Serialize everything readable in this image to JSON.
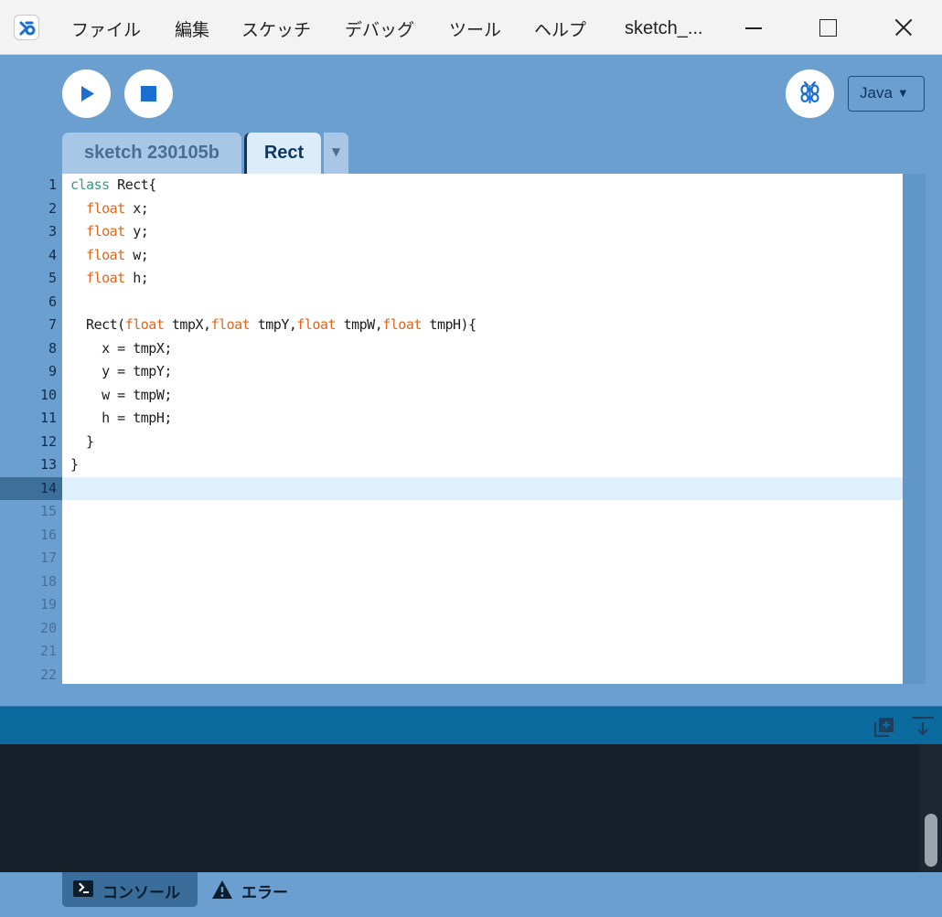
{
  "window": {
    "title": "sketch_...",
    "app_icon": "processing-logo-icon"
  },
  "menu": {
    "items": [
      "ファイル",
      "編集",
      "スケッチ",
      "デバッグ",
      "ツール",
      "ヘルプ"
    ]
  },
  "toolbar": {
    "run_icon": "play-icon",
    "stop_icon": "stop-icon",
    "debugger_icon": "butterfly-icon",
    "mode": "Java",
    "mode_caret": "▼"
  },
  "tabs": {
    "items": [
      {
        "label": "sketch 230105b",
        "active": false
      },
      {
        "label": "Rect",
        "active": true
      }
    ],
    "menu_caret": "▼"
  },
  "editor": {
    "line_numbers": [
      "1",
      "2",
      "3",
      "4",
      "5",
      "6",
      "7",
      "8",
      "9",
      "10",
      "11",
      "12",
      "13",
      "14",
      "15",
      "16",
      "17",
      "18",
      "19",
      "20",
      "21",
      "22"
    ],
    "current_line": "14",
    "lines": [
      "class Rect{",
      "  float x;",
      "  float y;",
      "  float w;",
      "  float h;",
      "",
      "  Rect(float tmpX,float tmpY,float tmpW,float tmpH){",
      "    x = tmpX;",
      "    y = tmpY;",
      "    w = tmpW;",
      "    h = tmpH;",
      "  }",
      "}",
      ""
    ],
    "colors": {
      "keyword_class": "#33997e",
      "keyword_type": "#e2661a",
      "text": "#1c1c1c",
      "current_line_bg": "#def0fc"
    }
  },
  "console": {
    "copy_icon": "copy-icon",
    "collapse_icon": "collapse-down-icon",
    "background": "#18212b"
  },
  "bottom_tabs": {
    "console_label": "コンソール",
    "console_icon": "terminal-icon",
    "errors_label": "エラー",
    "errors_icon": "warning-icon"
  },
  "theme": {
    "accent": "#6b9fcf",
    "console_header": "#0b6b9e"
  }
}
